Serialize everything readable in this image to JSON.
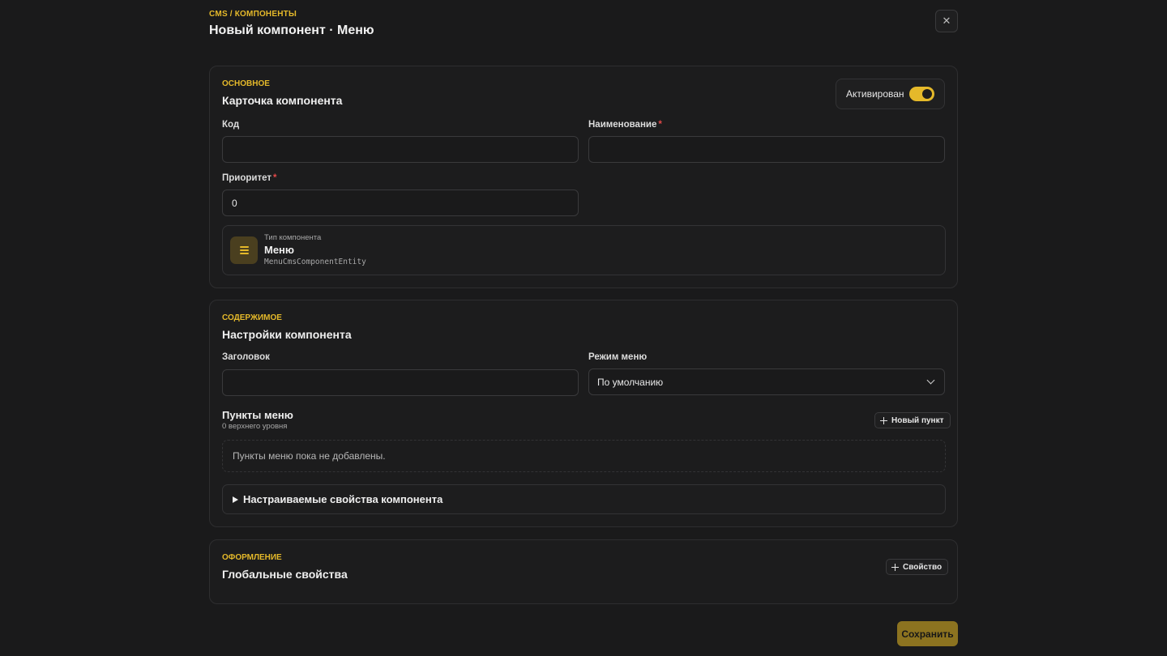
{
  "header": {
    "breadcrumb": "CMS / КОМПОНЕНТЫ",
    "title": "Новый компонент · Меню",
    "close_icon": "close-icon"
  },
  "basic": {
    "eyebrow": "ОСНОВНОЕ",
    "title": "Карточка компонента",
    "active_label": "Активирован",
    "active": true,
    "code_label": "Код",
    "code_value": "",
    "name_label": "Наименование",
    "name_value": "",
    "priority_label": "Приоритет",
    "priority_value": "0",
    "required_mark": "*",
    "type_caption": "Тип компонента",
    "type_name": "Меню",
    "type_code": "MenuCmsComponentEntity",
    "type_icon": "menu-icon"
  },
  "content": {
    "eyebrow": "СОДЕРЖИМОЕ",
    "title": "Настройки компонента",
    "heading_label": "Заголовок",
    "heading_value": "",
    "mode_label": "Режим меню",
    "mode_value": "По умолчанию",
    "items_title": "Пункты меню",
    "items_caption": "0 верхнего уровня",
    "new_item_label": "Новый пункт",
    "empty_text": "Пункты меню пока не добавлены.",
    "custom_props_label": "Настраиваемые свойства компонента"
  },
  "design": {
    "eyebrow": "ОФОРМЛЕНИЕ",
    "title": "Глобальные свойства",
    "add_property_label": "Свойство"
  },
  "footer": {
    "save_label": "Сохранить"
  },
  "colors": {
    "background": "#1a1a1b",
    "accent": "#e5b92a",
    "required": "#e24848",
    "save_button": "#8c7320"
  }
}
